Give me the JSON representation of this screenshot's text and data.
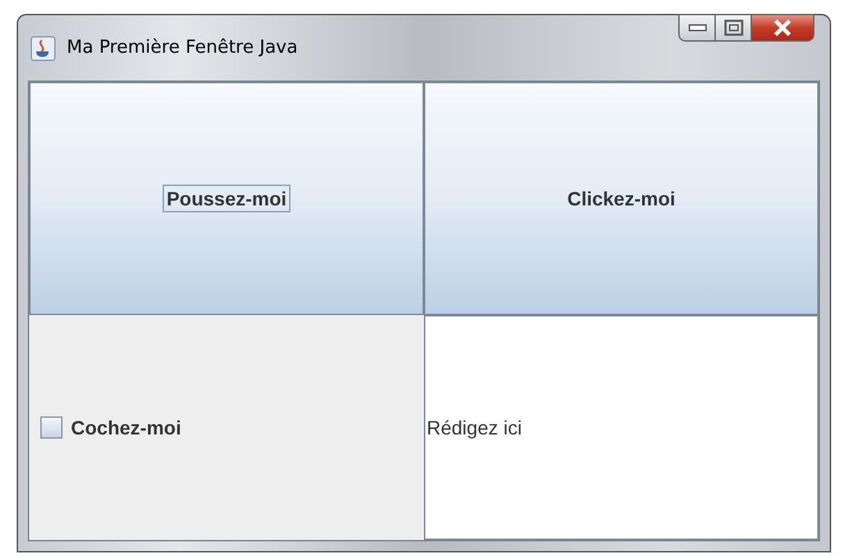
{
  "window": {
    "title": "Ma Première Fenêtre Java"
  },
  "buttons": [
    {
      "label": "Poussez-moi",
      "focused": true
    },
    {
      "label": "Clickez-moi",
      "focused": false
    }
  ],
  "checkbox": {
    "label": "Cochez-moi",
    "checked": false
  },
  "text_field": {
    "value": "Rédigez ici"
  }
}
